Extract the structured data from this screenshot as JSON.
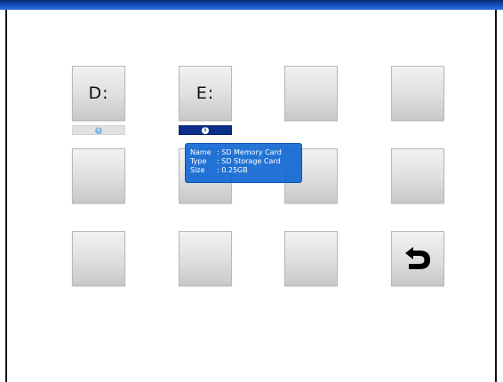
{
  "drives": [
    {
      "letter": "D:"
    },
    {
      "letter": "E:"
    }
  ],
  "info_bars": [
    {
      "state": "idle"
    },
    {
      "state": "active"
    }
  ],
  "tooltip": {
    "rows": [
      {
        "key": "Name",
        "value": ": SD Memory Card"
      },
      {
        "key": "Type",
        "value": ": SD Storage Card"
      },
      {
        "key": "Size",
        "value": ": 0.25GB"
      }
    ]
  },
  "icons": {
    "info": "info-icon",
    "info_glyph": "i",
    "return": "return-arrow-icon"
  },
  "colors": {
    "title_strip": "#1652c4",
    "info_active": "#0a2e8a",
    "info_idle": "#e1e1e1",
    "tooltip_bg": "#1068d2"
  }
}
